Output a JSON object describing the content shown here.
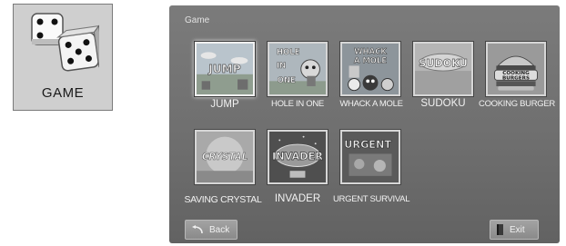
{
  "side_icon": {
    "label": "GAME"
  },
  "screen": {
    "title": "Game"
  },
  "games": [
    {
      "label": "JUMP",
      "art": "JUMP"
    },
    {
      "label": "HOLE IN ONE",
      "art": "HOLE IN ONE"
    },
    {
      "label": "WHACK A MOLE",
      "art": "WHACK A MOLE"
    },
    {
      "label": "SUDOKU",
      "art": "SUDOKU"
    },
    {
      "label": "COOKING BURGER",
      "art": "COOKING BURGERS"
    },
    {
      "label": "SAVING CRYSTAL",
      "art": "CRYSTAL"
    },
    {
      "label": "INVADER",
      "art": "INVADER"
    },
    {
      "label": "URGENT SURVIVAL",
      "art": "URGENT"
    }
  ],
  "selected_index": 0,
  "buttons": {
    "back_label": "Back",
    "exit_label": "Exit"
  },
  "icons": {
    "back": "back-arrow-icon",
    "exit": "door-icon",
    "game": "dice-icon"
  }
}
